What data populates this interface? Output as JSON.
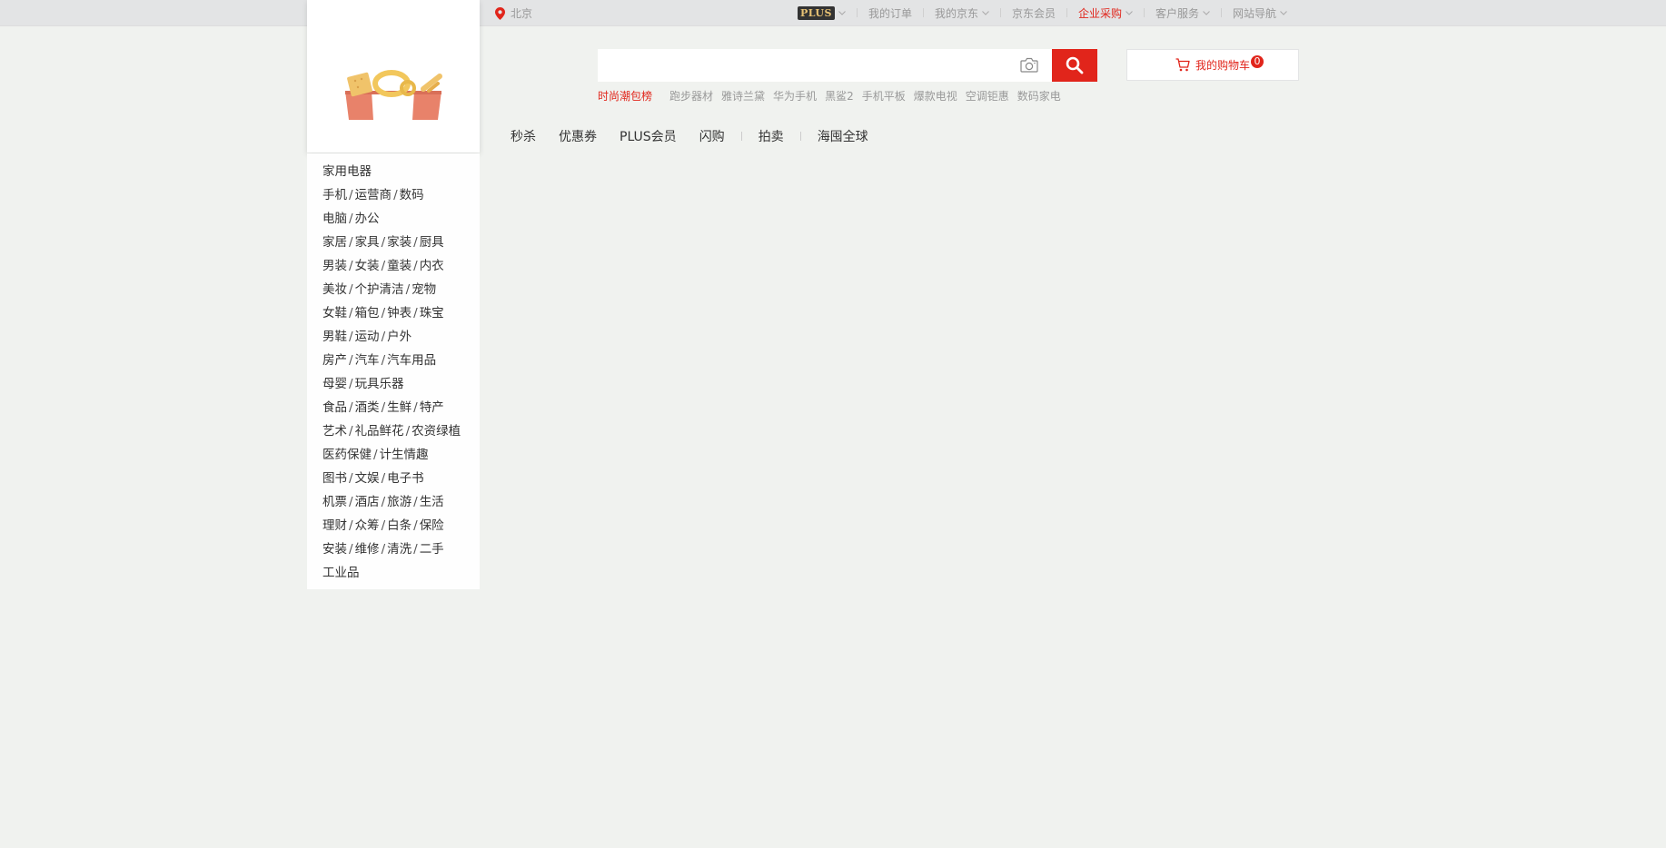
{
  "topbar": {
    "location": "北京",
    "plus_badge": "PLUS",
    "nav": [
      {
        "label": "我的订单",
        "dropdown": false,
        "red": false
      },
      {
        "label": "我的京东",
        "dropdown": true,
        "red": false
      },
      {
        "label": "京东会员",
        "dropdown": false,
        "red": false
      },
      {
        "label": "企业采购",
        "dropdown": true,
        "red": true
      },
      {
        "label": "客户服务",
        "dropdown": true,
        "red": false
      },
      {
        "label": "网站导航",
        "dropdown": true,
        "red": false
      }
    ]
  },
  "search": {
    "placeholder": "",
    "hotwords": [
      "时尚潮包榜",
      "跑步器材",
      "雅诗兰黛",
      "华为手机",
      "黑鲨2",
      "手机平板",
      "爆款电视",
      "空调钜惠",
      "数码家电"
    ]
  },
  "cart": {
    "label": "我的购物车",
    "count": "0"
  },
  "channels": [
    "秒杀",
    "优惠券",
    "PLUS会员",
    "闪购",
    "拍卖",
    "海囤全球"
  ],
  "categories": [
    [
      "家用电器"
    ],
    [
      "手机",
      "运营商",
      "数码"
    ],
    [
      "电脑",
      "办公"
    ],
    [
      "家居",
      "家具",
      "家装",
      "厨具"
    ],
    [
      "男装",
      "女装",
      "童装",
      "内衣"
    ],
    [
      "美妆",
      "个护清洁",
      "宠物"
    ],
    [
      "女鞋",
      "箱包",
      "钟表",
      "珠宝"
    ],
    [
      "男鞋",
      "运动",
      "户外"
    ],
    [
      "房产",
      "汽车",
      "汽车用品"
    ],
    [
      "母婴",
      "玩具乐器"
    ],
    [
      "食品",
      "酒类",
      "生鲜",
      "特产"
    ],
    [
      "艺术",
      "礼品鲜花",
      "农资绿植"
    ],
    [
      "医药保健",
      "计生情趣"
    ],
    [
      "图书",
      "文娱",
      "电子书"
    ],
    [
      "机票",
      "酒店",
      "旅游",
      "生活"
    ],
    [
      "理财",
      "众筹",
      "白条",
      "保险"
    ],
    [
      "安装",
      "维修",
      "清洗",
      "二手"
    ],
    [
      "工业品"
    ]
  ],
  "colors": {
    "accent": "#e1251b",
    "background": "#f0f2ef",
    "topbar": "#e3e4e5"
  }
}
